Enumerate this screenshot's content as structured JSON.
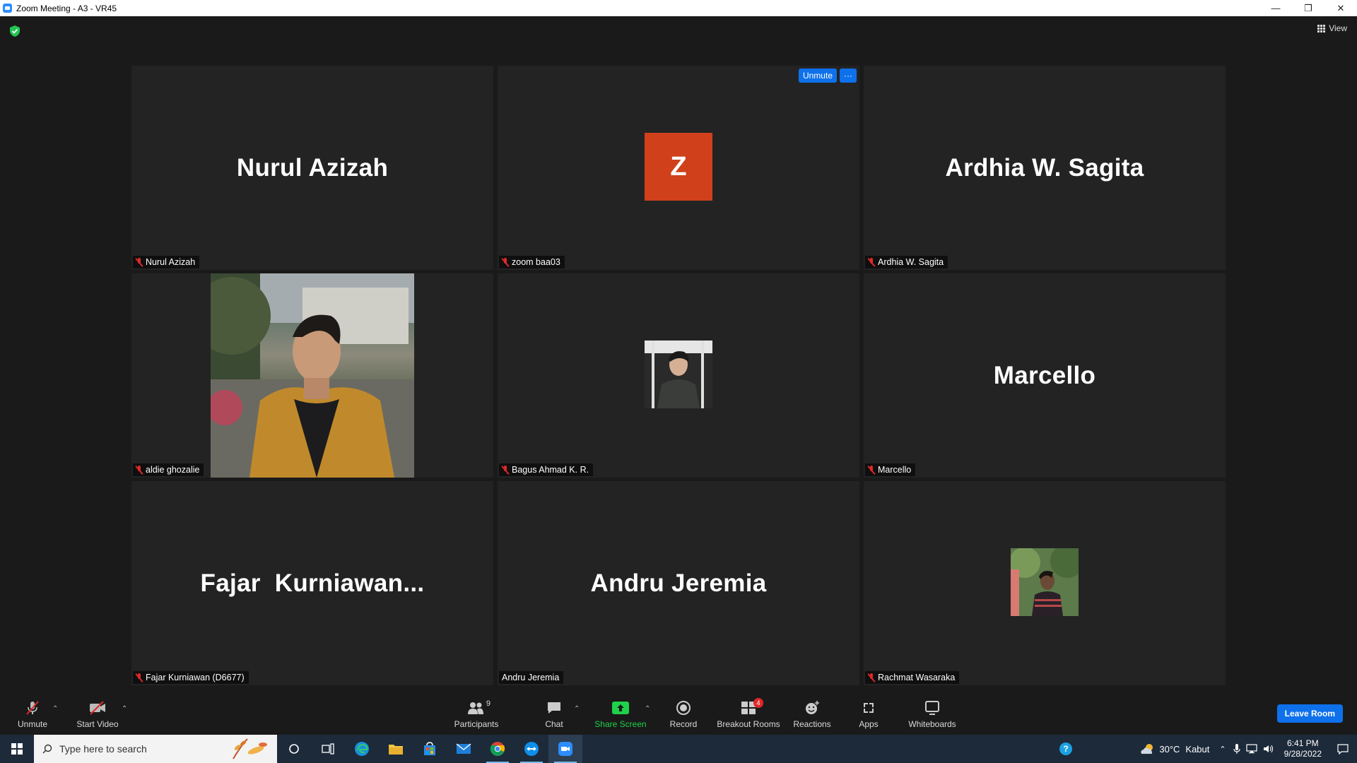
{
  "window": {
    "title": "Zoom Meeting - A3 - VR45"
  },
  "top": {
    "view_label": "View"
  },
  "tiles": [
    {
      "big_name": "Nurul Azizah",
      "label": "Nurul Azizah",
      "muted": true
    },
    {
      "avatar_letter": "Z",
      "label": "zoom baa03",
      "muted": true,
      "actions": [
        "Unmute",
        "···"
      ]
    },
    {
      "big_name": "Ardhia W. Sagita",
      "label": "Ardhia W. Sagita",
      "muted": true
    },
    {
      "label": "aldie ghozalie",
      "muted": true,
      "video": "photo"
    },
    {
      "label": "Bagus Ahmad K. R.",
      "muted": true,
      "video": "photo-small"
    },
    {
      "big_name": "Marcello",
      "label": "Marcello",
      "muted": true
    },
    {
      "big_name": "Fajar  Kurniawan...",
      "label": "Fajar Kurniawan (D6677)",
      "muted": true
    },
    {
      "big_name": "Andru Jeremia",
      "label": "Andru Jeremia",
      "muted": false
    },
    {
      "label": "Rachmat Wasaraka",
      "muted": true,
      "video": "photo-small"
    }
  ],
  "toolbar": {
    "unmute": "Unmute",
    "start_video": "Start Video",
    "participants": "Participants",
    "participants_count": "9",
    "chat": "Chat",
    "share_screen": "Share Screen",
    "record": "Record",
    "breakout_rooms": "Breakout Rooms",
    "breakout_badge": "4",
    "reactions": "Reactions",
    "apps": "Apps",
    "whiteboards": "Whiteboards",
    "leave": "Leave Room"
  },
  "taskbar": {
    "search_placeholder": "Type here to search",
    "weather_temp": "30°C",
    "weather_text": "Kabut",
    "time": "6:41 PM",
    "date": "9/28/2022"
  },
  "colors": {
    "accent": "#0e71eb",
    "share_green": "#1fd14b",
    "muted_red": "#e02828",
    "avatar_orange": "#d0401b"
  }
}
